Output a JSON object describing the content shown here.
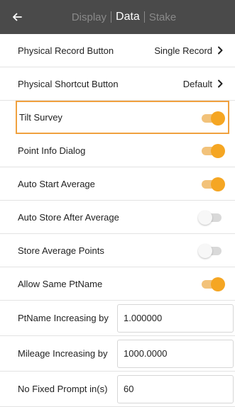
{
  "header": {
    "tabs": [
      {
        "label": "Display",
        "active": false
      },
      {
        "label": "Data",
        "active": true
      },
      {
        "label": "Stake",
        "active": false
      }
    ]
  },
  "settings": {
    "physical_record_button": {
      "label": "Physical Record Button",
      "value": "Single Record"
    },
    "physical_shortcut_button": {
      "label": "Physical Shortcut Button",
      "value": "Default"
    },
    "tilt_survey": {
      "label": "Tilt Survey",
      "on": true
    },
    "point_info_dialog": {
      "label": "Point Info Dialog",
      "on": true
    },
    "auto_start_average": {
      "label": "Auto Start Average",
      "on": true
    },
    "auto_store_after_average": {
      "label": "Auto Store After Average",
      "on": false
    },
    "store_average_points": {
      "label": "Store Average Points",
      "on": false
    },
    "allow_same_ptname": {
      "label": "Allow Same PtName",
      "on": true
    },
    "ptname_increasing_by": {
      "label": "PtName Increasing by",
      "value": "1.000000"
    },
    "mileage_increasing_by": {
      "label": "Mileage Increasing by",
      "value": "1000.0000"
    },
    "no_fixed_prompt": {
      "label": "No Fixed Prompt in(s)",
      "value": "60"
    }
  },
  "colors": {
    "accent": "#f5a623",
    "highlight_border": "#f0a13f",
    "header_bg": "#4a4a4a"
  },
  "icons": {
    "back": "arrow-left-icon",
    "chevron": "chevron-right-icon"
  }
}
